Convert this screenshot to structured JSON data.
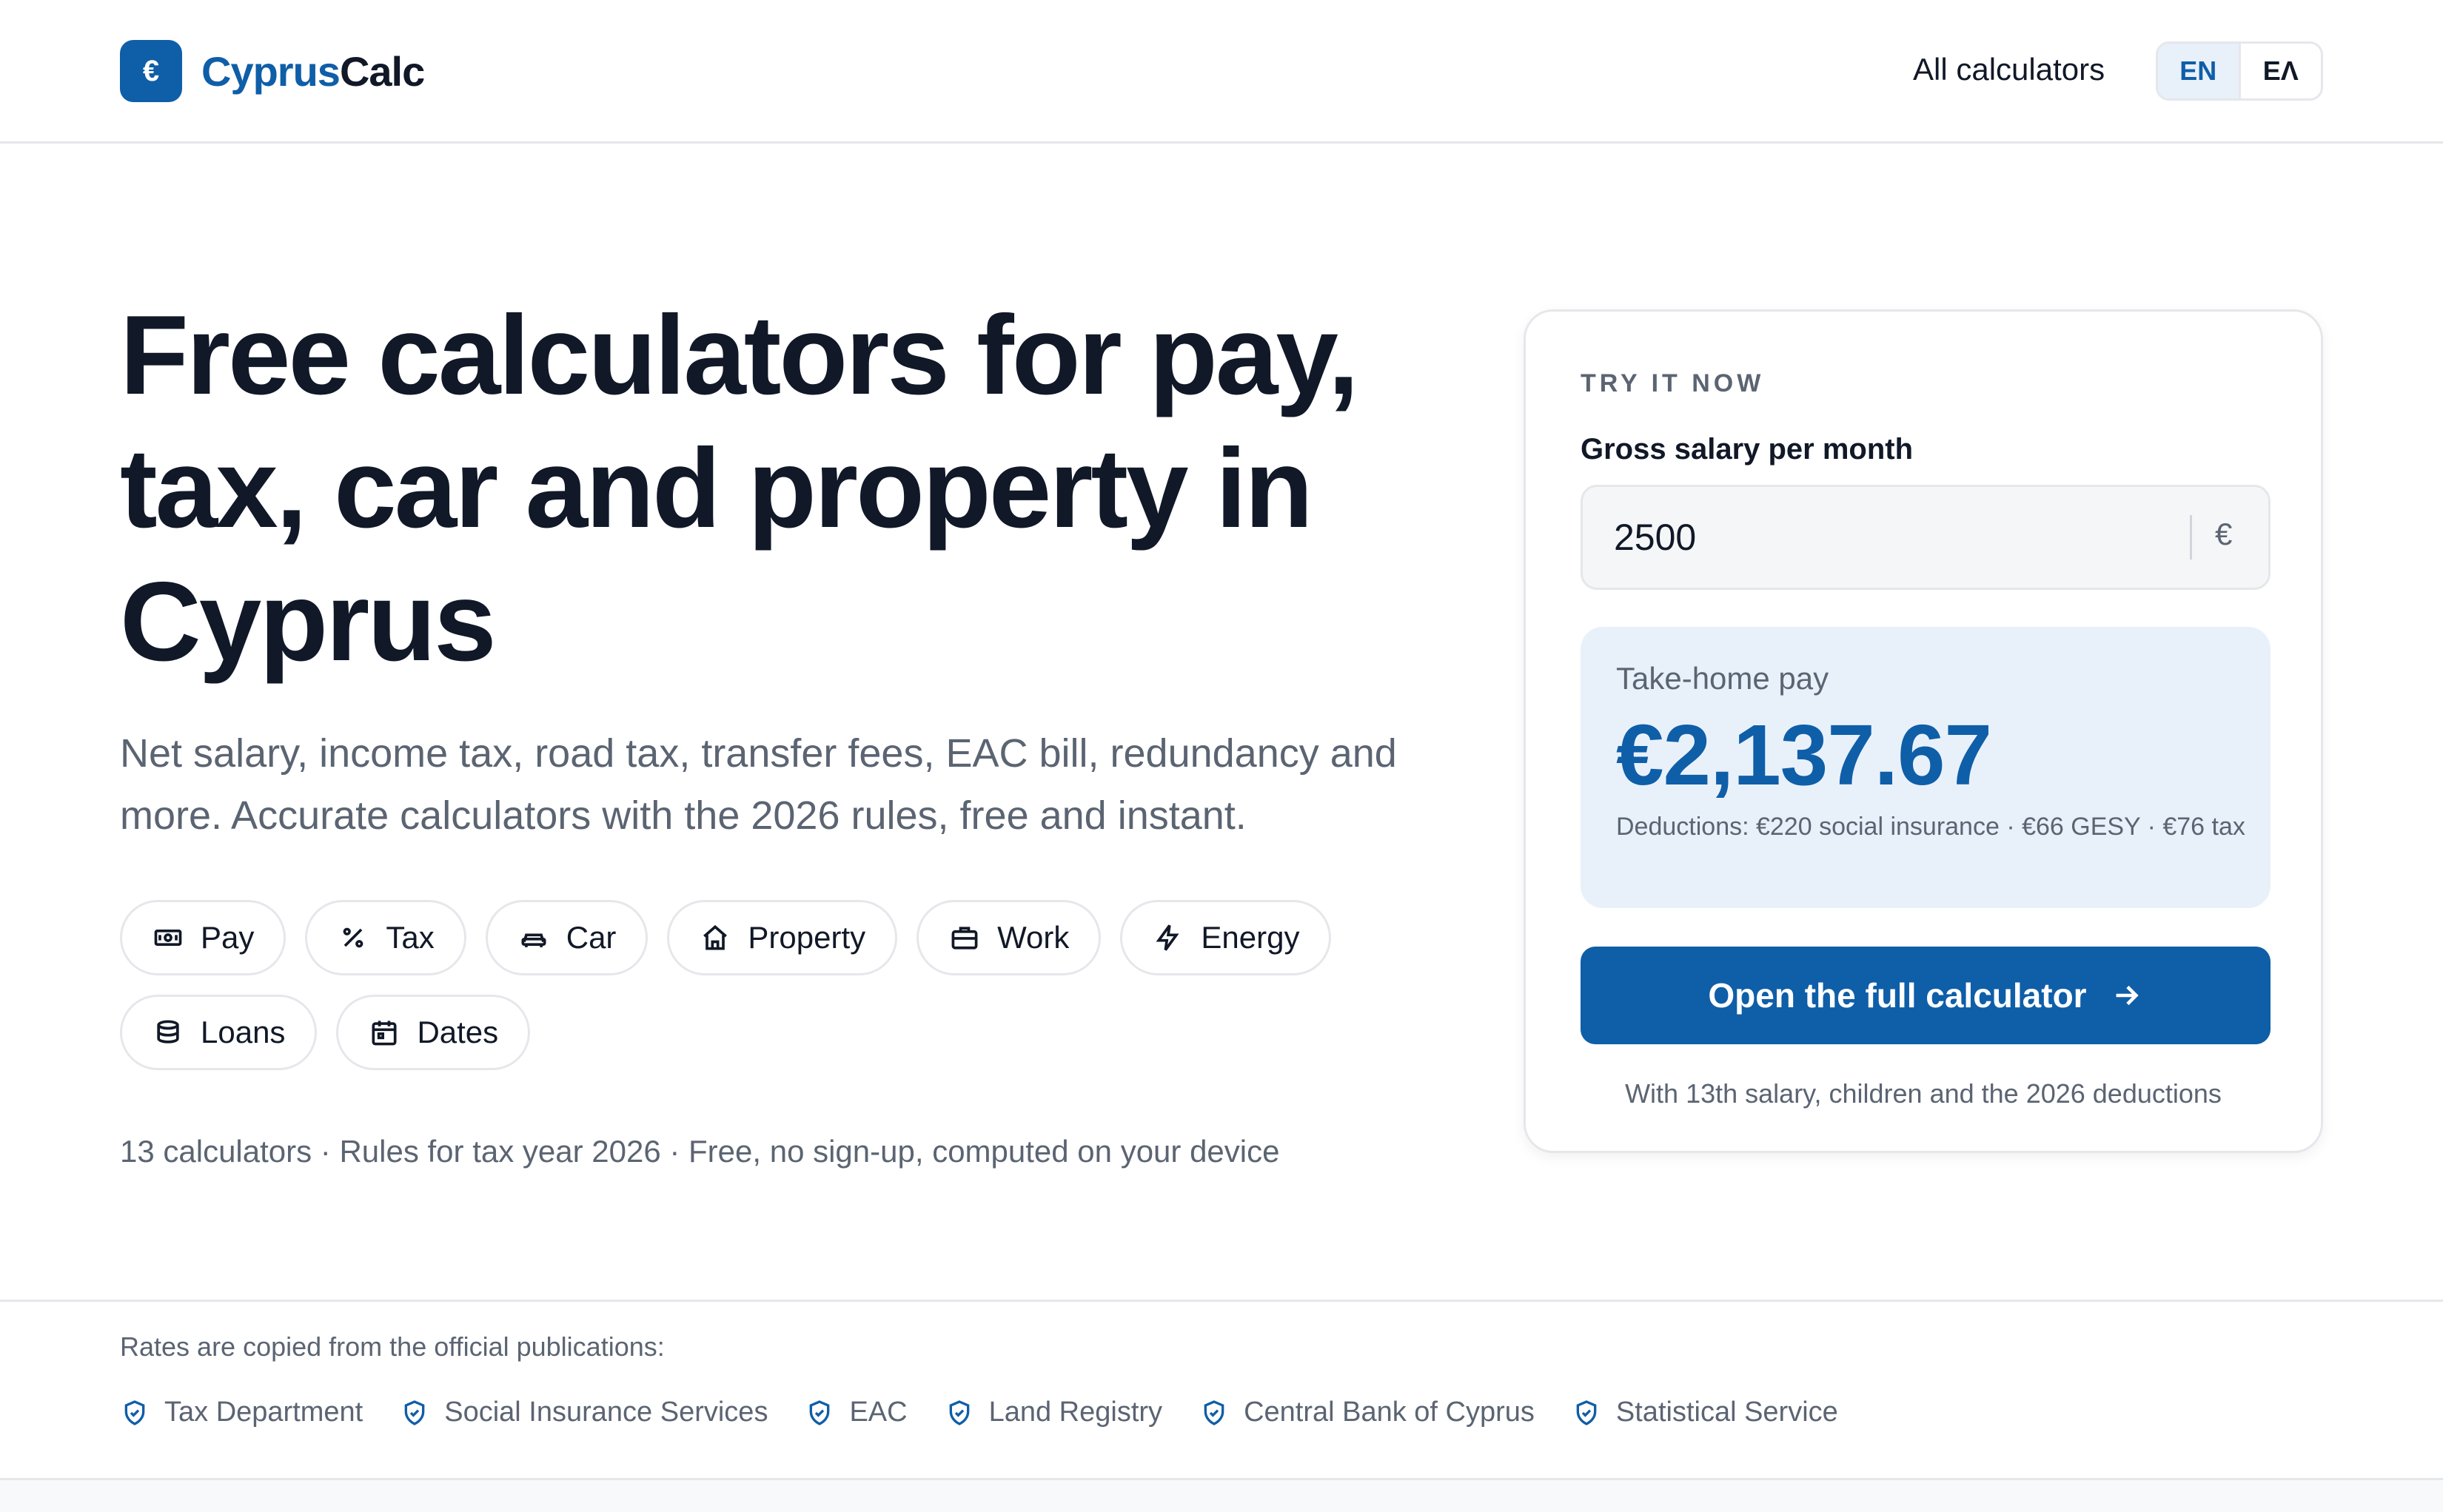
{
  "header": {
    "logo_symbol": "€",
    "logo_part1": "Cyprus",
    "logo_part2": "Calc",
    "nav_all": "All calculators",
    "lang_en": "EN",
    "lang_el": "ΕΛ"
  },
  "hero": {
    "title": "Free calculators for pay, tax, car and property in Cyprus",
    "subtitle": "Net salary, income tax, road tax, transfer fees, EAC bill, redundancy and more. Accurate calculators with the 2026 rules, free and instant.",
    "chips": [
      {
        "label": "Pay",
        "icon": "banknote-icon"
      },
      {
        "label": "Tax",
        "icon": "percent-icon"
      },
      {
        "label": "Car",
        "icon": "car-icon"
      },
      {
        "label": "Property",
        "icon": "home-icon"
      },
      {
        "label": "Work",
        "icon": "briefcase-icon"
      },
      {
        "label": "Energy",
        "icon": "bolt-icon"
      },
      {
        "label": "Loans",
        "icon": "coins-icon"
      },
      {
        "label": "Dates",
        "icon": "calendar-icon"
      }
    ],
    "meta": "13 calculators · Rules for tax year 2026 · Free, no sign-up, computed on your device"
  },
  "card": {
    "eyebrow": "TRY IT NOW",
    "field_label": "Gross salary per month",
    "input_value": "2500",
    "input_unit": "€",
    "result_label": "Take-home pay",
    "result_value": "€2,137.67",
    "result_note": "Deductions: €220 social insurance · €66 GESY · €76 tax",
    "cta_label": "Open the full calculator",
    "cta_note": "With 13th salary, children and the 2026 deductions"
  },
  "sources": {
    "title": "Rates are copied from the official publications:",
    "items": [
      "Tax Department",
      "Social Insurance Services",
      "EAC",
      "Land Registry",
      "Central Bank of Cyprus",
      "Statistical Service"
    ]
  },
  "colors": {
    "brand": "#0f5ea8",
    "text": "#111827",
    "muted": "#5b6472",
    "result_bg": "#e8f1fa"
  }
}
